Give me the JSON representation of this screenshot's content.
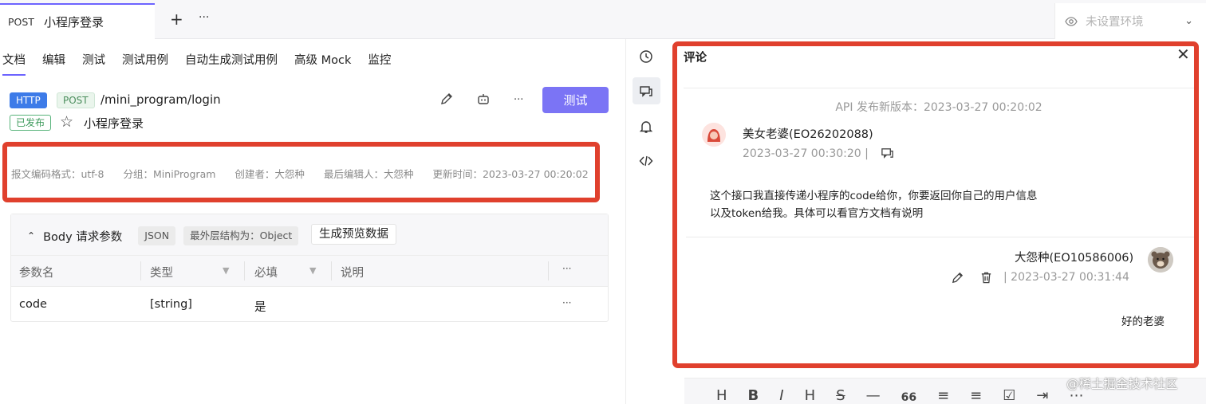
{
  "tab": {
    "method": "POST",
    "title": "小程序登录",
    "add": "+",
    "more": "···"
  },
  "env": {
    "placeholder": "未设置环境"
  },
  "subtabs": [
    "文档",
    "编辑",
    "测试",
    "测试用例",
    "自动生成测试用例",
    "高级 Mock",
    "监控"
  ],
  "api": {
    "protocol": "HTTP",
    "method": "POST",
    "path": "/mini_program/login",
    "status": "已发布",
    "name": "小程序登录",
    "test_label": "测试",
    "more": "···"
  },
  "meta": {
    "encoding": "报文编码格式：utf-8",
    "group": "分组：MiniProgram",
    "creator": "创建者：大怨种",
    "last_editor": "最后编辑人：大怨种",
    "updated": "更新时间：2023-03-27 00:20:02"
  },
  "body": {
    "title": "Body 请求参数",
    "format": "JSON",
    "structure": "最外层结构为：Object",
    "generate": "生成预览数据",
    "columns": [
      "参数名",
      "类型",
      "必填",
      "说明"
    ],
    "more": "···",
    "rows": [
      {
        "name": "code",
        "type": "[string]",
        "required": "是",
        "more": "···"
      }
    ]
  },
  "comments": {
    "title": "评论",
    "version": "API 发布新版本：2023-03-27 00:20:02",
    "c1": {
      "author": "美女老婆(EO26202088)",
      "time": "2023-03-27 00:30:20 |",
      "line1": "这个接口我直接传递小程序的code给你，你要返回你自己的用户信息",
      "line2": "以及token给我。具体可以看官方文档有说明"
    },
    "c2": {
      "author": "大怨种(EO10586006)",
      "time": "| 2023-03-27 00:31:44",
      "body": "好的老婆"
    }
  },
  "toolbar": [
    "H",
    "B",
    "I",
    "H",
    "S",
    "—",
    "66"
  ],
  "watermark": "@稀土掘金技术社区",
  "colors": {
    "accent": "#6c63ff",
    "button": "#7b74f5",
    "http": "#3d7be8",
    "highlight": "#e0402d"
  }
}
